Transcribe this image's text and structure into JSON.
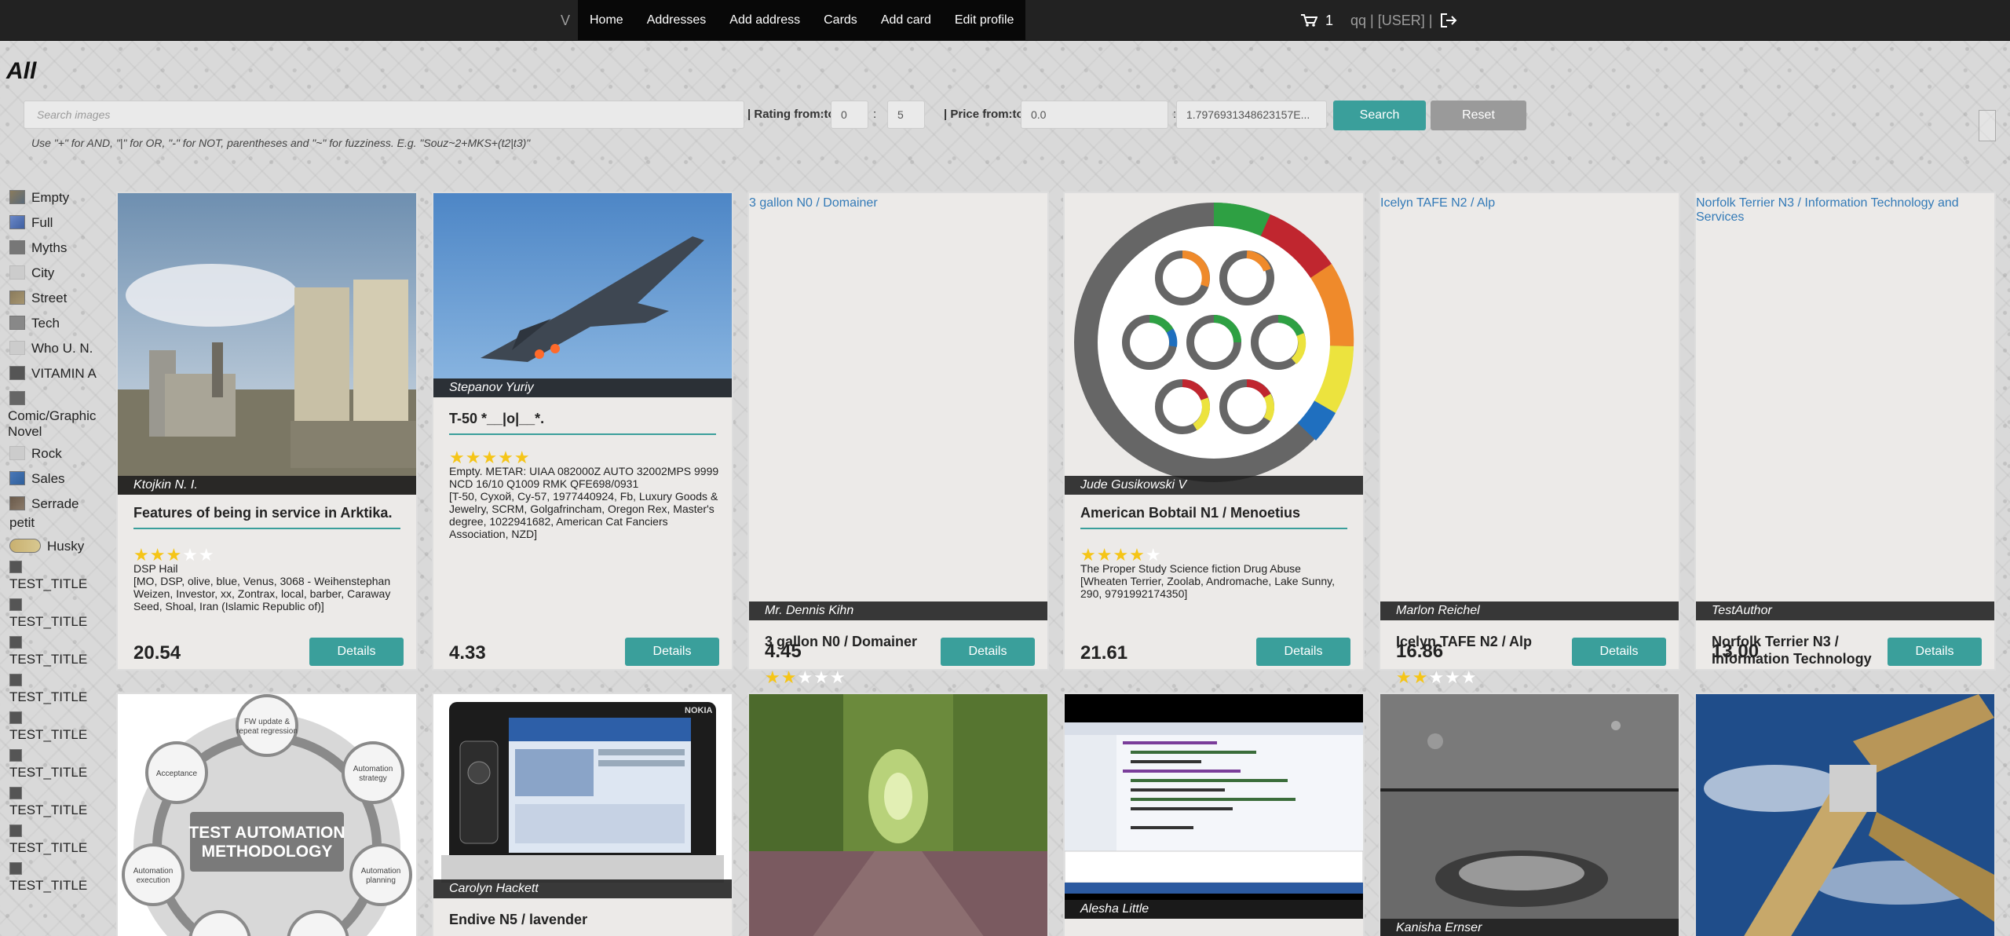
{
  "nav": {
    "brand": "V",
    "links": [
      "Home",
      "Addresses",
      "Add address",
      "Cards",
      "Add card",
      "Edit profile"
    ],
    "cart_count": "1",
    "user_text": "qq | [USER] |"
  },
  "page": {
    "title": "All"
  },
  "search": {
    "placeholder": "Search images",
    "rating_label": "| Rating from:to",
    "rating_from": "0",
    "rating_to": "5",
    "price_label": "| Price from:to",
    "price_from": "0.0",
    "price_to": "1.7976931348623157E...",
    "search_label": "Search",
    "reset_label": "Reset",
    "hint": "Use \"+\" for AND, \"|\" for OR, \"-\" for NOT, parentheses and \"~\" for fuzziness. E.g. \"Souz~2+MKS+(t2|t3)\""
  },
  "sidebar": {
    "categories": [
      "Empty",
      "Full",
      "Myths",
      "City",
      "Street",
      "Tech",
      "Who U. N.",
      "VITAMIN A",
      "Comic/Graphic Novel",
      "Rock",
      "Sales",
      "Serrade petit",
      "Husky"
    ],
    "test_items": [
      "TEST_TITLE",
      "TEST_TITLE",
      "TEST_TITLE",
      "TEST_TITLE",
      "TEST_TITLE",
      "TEST_TITLE",
      "TEST_TITLE",
      "TEST_TITLE",
      "TEST_TITLE"
    ]
  },
  "cards": [
    {
      "author": "Ktojkin N. I.",
      "title": "Features of being in service in Arktika.",
      "rating": 3,
      "desc": "DSP Hail\n[MO, DSP, olive, blue, Venus, 3068 - Weihenstephan Weizen, Investor, xx, Zontrax, local, barber, Caraway Seed, Shoal, Iran (Islamic Republic of)]",
      "price": "20.54",
      "details": "Details"
    },
    {
      "author": "Stepanov Yuriy",
      "title": "T-50 *__|o|__*.",
      "rating": 5,
      "desc": "Empty. METAR: UIAA 082000Z AUTO 32002MPS 9999 NCD 16/10 Q1009 RMK QFE698/0931\n[T-50, Сухой, Су-57, 1977440924, Fb, Luxury Goods & Jewelry, SCRM, Golgafrincham, Oregon Rex, Master's degree, 1022941682, American Cat Fanciers Association, NZD]",
      "price": "4.33",
      "details": "Details"
    },
    {
      "broken_alt": "3 gallon N0 / Domainer",
      "author": "Mr. Dennis Kihn",
      "title": "3 gallon N0 / Domainer",
      "rating": 2,
      "desc": "",
      "price": "4.45",
      "details": "Details"
    },
    {
      "author": "Jude Gusikowski V",
      "title": "American Bobtail N1 / Menoetius",
      "rating": 4,
      "desc": "The Proper Study Science fiction Drug Abuse\n[Wheaten Terrier, Zoolab, Andromache, Lake Sunny, 290, 9791992174350]",
      "price": "21.61",
      "details": "Details"
    },
    {
      "broken_alt": "Icelyn TAFE N2 / Alp",
      "author": "Marlon Reichel",
      "title": "Icelyn TAFE N2 / Alp",
      "rating": 2,
      "desc": "",
      "price": "16.86",
      "details": "Details"
    },
    {
      "broken_alt": "Norfolk Terrier N3 / Information Technology and Services",
      "author": "TestAuthor",
      "title": "Norfolk Terrier N3 / Information Technology and Services",
      "rating": 0,
      "desc": "",
      "price": "13.00",
      "details": "Details"
    }
  ],
  "cards_row2": [
    {
      "author": "",
      "title": "",
      "diagram_center": "TEST AUTOMATION METHODOLOGY",
      "diagram_nodes": [
        "FW update & repeat regression",
        "Automation strategy",
        "Automation planning",
        "Automation execution",
        "Acceptance"
      ]
    },
    {
      "author": "Carolyn Hackett",
      "title": "Endive N5 / lavender",
      "device_brand": "NOKIA"
    },
    {
      "author": "",
      "title": ""
    },
    {
      "author": "Alesha Little",
      "title": ""
    },
    {
      "author": "Kanisha Ernser",
      "title": ""
    },
    {
      "author": "",
      "title": ""
    }
  ],
  "colors": {
    "accent": "#3a9f9b",
    "navbar": "#222222",
    "star": "#f5c518",
    "reset": "#9a9a9a"
  }
}
